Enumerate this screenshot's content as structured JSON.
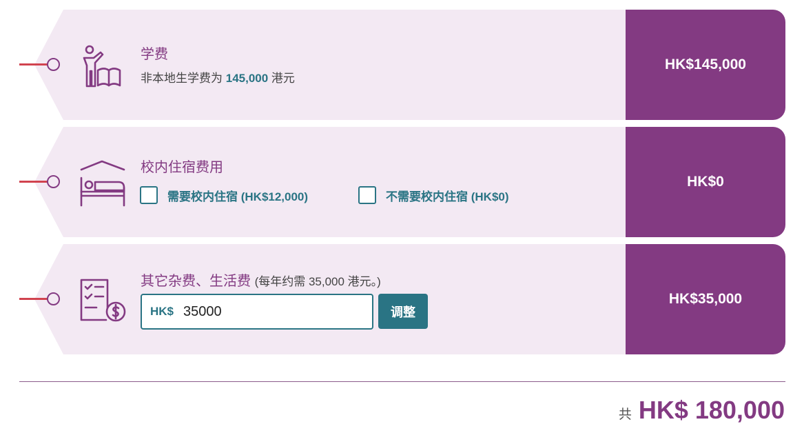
{
  "colors": {
    "accent": "#833a82",
    "teal": "#2a7484",
    "card_bg": "#f3e9f3",
    "string": "#d1434f"
  },
  "fees": [
    {
      "icon": "teacher-book-icon",
      "title": "学费",
      "desc_prefix": "非本地生学费为 ",
      "desc_amount": "145,000",
      "desc_suffix": " 港元",
      "price": "HK$145,000"
    },
    {
      "icon": "bed-house-icon",
      "title": "校内住宿费用",
      "options": [
        {
          "label": "需要校内住宿 (HK$12,000)",
          "checked": false
        },
        {
          "label": "不需要校内住宿 (HK$0)",
          "checked": false
        }
      ],
      "price": "HK$0"
    },
    {
      "icon": "checklist-dollar-icon",
      "title": "其它杂费、生活费",
      "note": "(每年约需 35,000 港元。)",
      "input_prefix": "HK$",
      "input_value": "35000",
      "button_label": "调整",
      "price": "HK$35,000"
    }
  ],
  "total": {
    "label": "共",
    "amount": "HK$ 180,000"
  }
}
